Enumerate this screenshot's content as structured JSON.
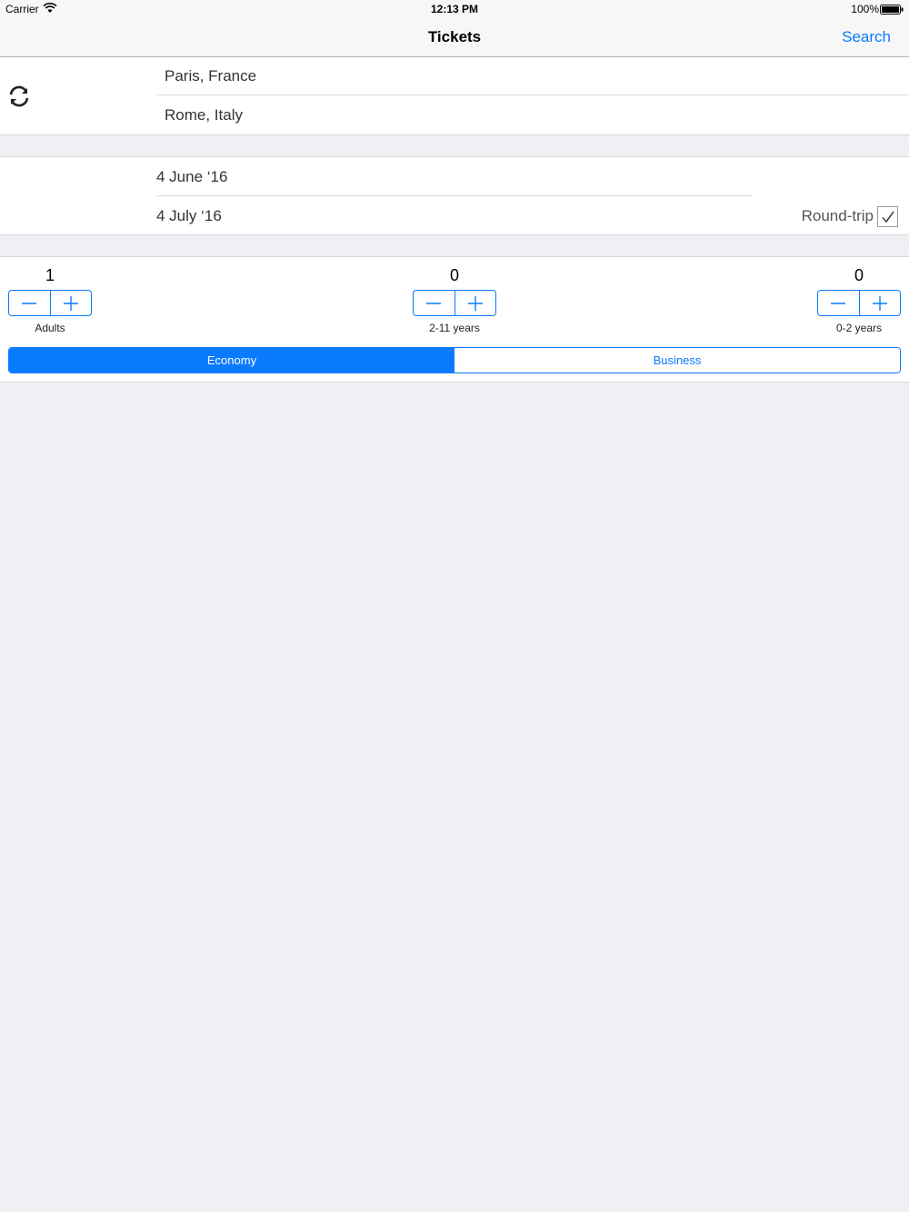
{
  "status_bar": {
    "carrier": "Carrier",
    "time": "12:13 PM",
    "battery": "100%"
  },
  "nav": {
    "title": "Tickets",
    "search_label": "Search"
  },
  "route": {
    "from": "Paris, France",
    "to": "Rome, Italy"
  },
  "dates": {
    "departure": "4 June ‘16",
    "return": "4 July ‘16",
    "roundtrip_label": "Round-trip",
    "roundtrip_checked": true
  },
  "passengers": [
    {
      "count": "1",
      "label": "Adults"
    },
    {
      "count": "0",
      "label": "2-11 years"
    },
    {
      "count": "0",
      "label": "0-2 years"
    }
  ],
  "cabin_class": {
    "options": [
      "Economy",
      "Business"
    ],
    "selected": "Economy"
  },
  "colors": {
    "accent": "#0a7aff",
    "background": "#efeff4"
  },
  "icons": {
    "swap": "refresh-icon",
    "check": "checkmark-icon",
    "minus": "minus-icon",
    "plus": "plus-icon"
  }
}
